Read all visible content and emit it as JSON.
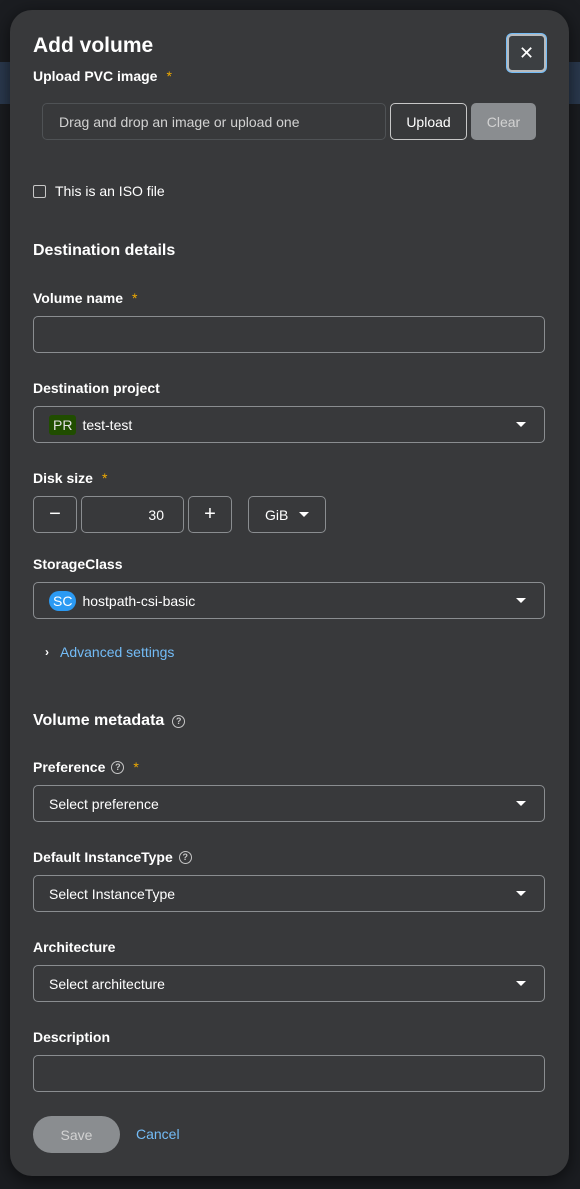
{
  "modal": {
    "title": "Add volume",
    "close_icon": "close-icon"
  },
  "upload": {
    "label": "Upload PVC image",
    "required_mark": "*",
    "placeholder": "Drag and drop an image or upload one",
    "upload_label": "Upload",
    "clear_label": "Clear"
  },
  "iso": {
    "label": "This is an ISO file",
    "checked": false
  },
  "destination": {
    "section_title": "Destination details",
    "volume_name_label": "Volume name",
    "volume_name_value": "",
    "project_label": "Destination project",
    "project_badge": "PR",
    "project_value": "test-test",
    "disk_size_label": "Disk size",
    "disk_decrement": "−",
    "disk_increment": "+",
    "disk_value": "30",
    "disk_unit": "GiB",
    "storage_class_label": "StorageClass",
    "storage_class_badge": "SC",
    "storage_class_value": "hostpath-csi-basic",
    "advanced_label": "Advanced settings"
  },
  "metadata": {
    "section_title": "Volume metadata",
    "preference_label": "Preference",
    "preference_value": "Select preference",
    "instancetype_label": "Default InstanceType",
    "instancetype_value": "Select InstanceType",
    "architecture_label": "Architecture",
    "architecture_value": "Select architecture",
    "description_label": "Description",
    "description_value": ""
  },
  "footer": {
    "save_label": "Save",
    "cancel_label": "Cancel"
  },
  "colors": {
    "accent_link": "#73bcf7",
    "required": "#f0ab00",
    "project_badge_bg": "#204d00",
    "storage_badge_bg": "#2b9af3"
  }
}
